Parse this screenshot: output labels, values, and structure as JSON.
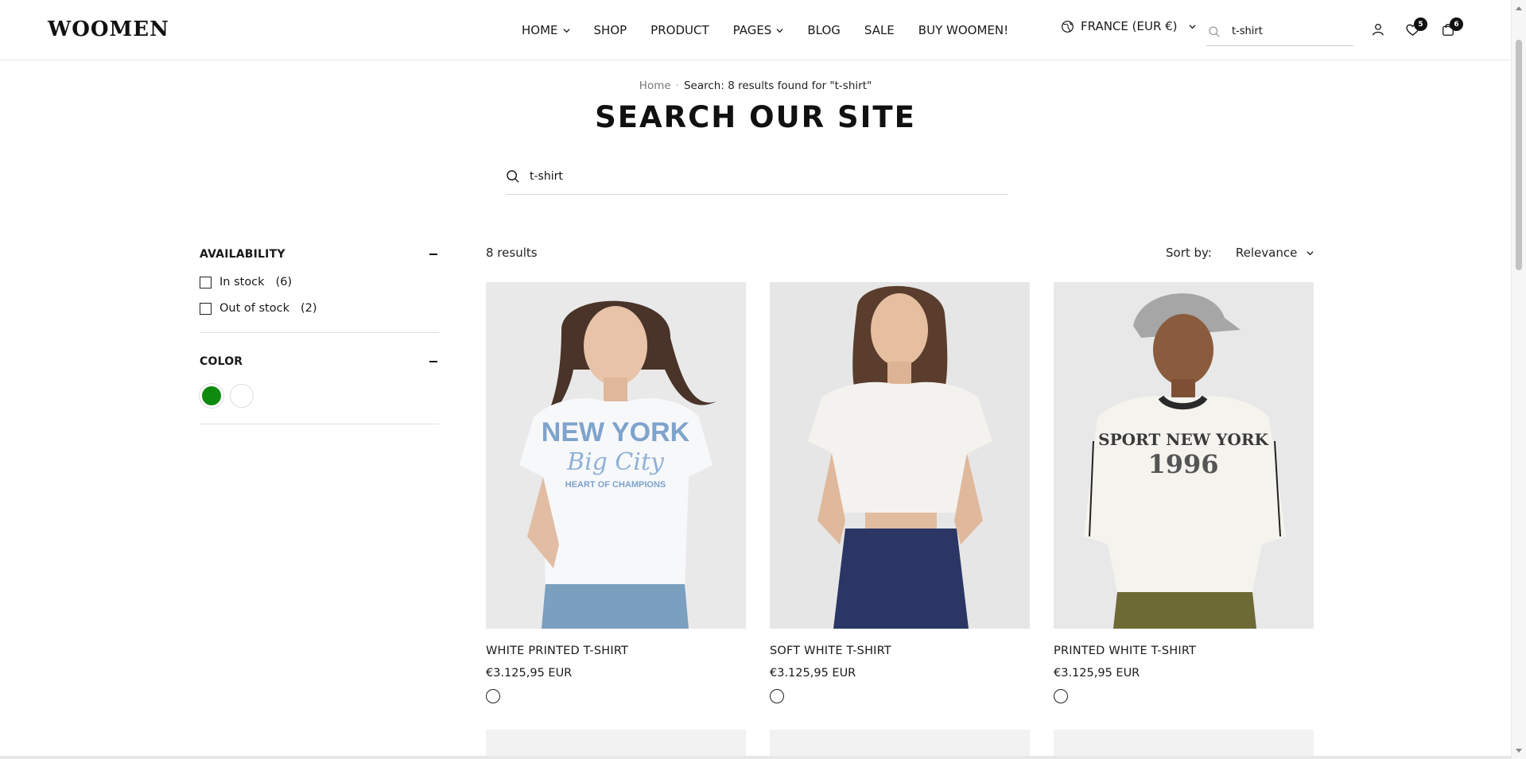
{
  "header": {
    "logo": "WOOMEN",
    "nav": [
      {
        "label": "HOME",
        "has_dropdown": true
      },
      {
        "label": "SHOP",
        "has_dropdown": false
      },
      {
        "label": "PRODUCT",
        "has_dropdown": false
      },
      {
        "label": "PAGES",
        "has_dropdown": true
      },
      {
        "label": "BLOG",
        "has_dropdown": false
      },
      {
        "label": "SALE",
        "has_dropdown": false
      },
      {
        "label": "BUY WOOMEN!",
        "has_dropdown": false
      }
    ],
    "locale": "FRANCE (EUR €)",
    "search_value": "t-shirt",
    "wishlist_count": "5",
    "cart_count": "6"
  },
  "breadcrumb": {
    "home": "Home",
    "separator": "·",
    "current": "Search: 8 results found for \"t-shirt\""
  },
  "page_title": "SEARCH OUR SITE",
  "main_search": {
    "value": "t-shirt"
  },
  "filters": {
    "availability": {
      "title": "AVAILABILITY",
      "options": [
        {
          "label": "In stock",
          "count": "(6)"
        },
        {
          "label": "Out of stock",
          "count": "(2)"
        }
      ]
    },
    "color": {
      "title": "COLOR",
      "swatches": [
        "#0f8a0f",
        "#ffffff"
      ]
    }
  },
  "results": {
    "count_label": "8 results",
    "sort_label": "Sort by:",
    "sort_value": "Relevance",
    "products": [
      {
        "name": "WHITE PRINTED T-SHIRT",
        "price": "€3.125,95 EUR",
        "image_text_top": "NEW YORK",
        "image_text_mid": "Big City",
        "image_text_bot": "HEART OF CHAMPIONS"
      },
      {
        "name": "SOFT WHITE T-SHIRT",
        "price": "€3.125,95 EUR"
      },
      {
        "name": "PRINTED WHITE T-SHIRT",
        "price": "€3.125,95 EUR",
        "image_text_top": "SPORT NEW YORK",
        "image_text_mid": "1996"
      }
    ]
  },
  "colors": {
    "text": "#1a1a1a",
    "image_bg": "#ececec",
    "accent_green": "#0f8a0f"
  }
}
